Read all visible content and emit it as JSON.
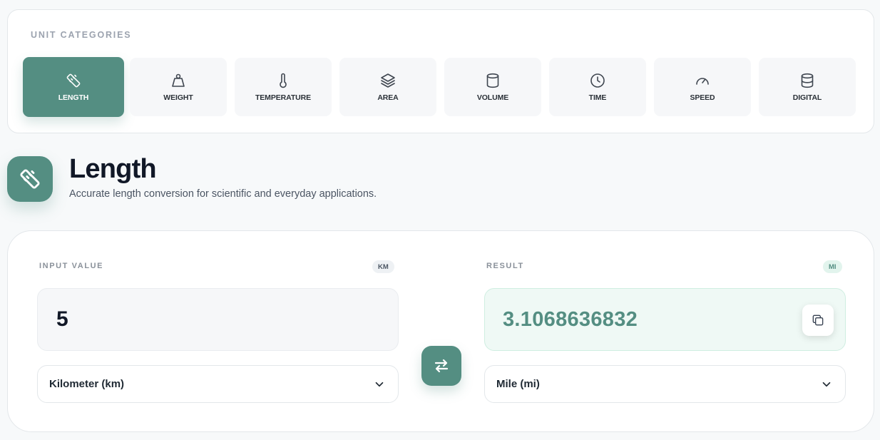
{
  "categories": {
    "heading": "UNIT CATEGORIES",
    "items": [
      {
        "label": "LENGTH",
        "icon": "ruler-icon",
        "active": true
      },
      {
        "label": "WEIGHT",
        "icon": "weight-icon",
        "active": false
      },
      {
        "label": "TEMPERATURE",
        "icon": "thermometer-icon",
        "active": false
      },
      {
        "label": "AREA",
        "icon": "layers-icon",
        "active": false
      },
      {
        "label": "VOLUME",
        "icon": "cylinder-icon",
        "active": false
      },
      {
        "label": "TIME",
        "icon": "clock-icon",
        "active": false
      },
      {
        "label": "SPEED",
        "icon": "gauge-icon",
        "active": false
      },
      {
        "label": "DIGITAL",
        "icon": "database-icon",
        "active": false
      }
    ]
  },
  "header": {
    "icon": "ruler-icon",
    "title": "Length",
    "subtitle": "Accurate length conversion for scientific and everyday applications."
  },
  "converter": {
    "input": {
      "label": "INPUT VALUE",
      "unit_chip": "KM",
      "value": "5",
      "unit_select": "Kilometer (km)"
    },
    "result": {
      "label": "RESULT",
      "unit_chip": "MI",
      "value": "3.1068636832",
      "unit_select": "Mile (mi)",
      "copy_icon": "copy-icon"
    },
    "swap_icon": "swap-arrows-icon"
  },
  "colors": {
    "accent": "#548e82",
    "result_bg": "#eff9f5",
    "page_bg": "#f7f9fa"
  }
}
